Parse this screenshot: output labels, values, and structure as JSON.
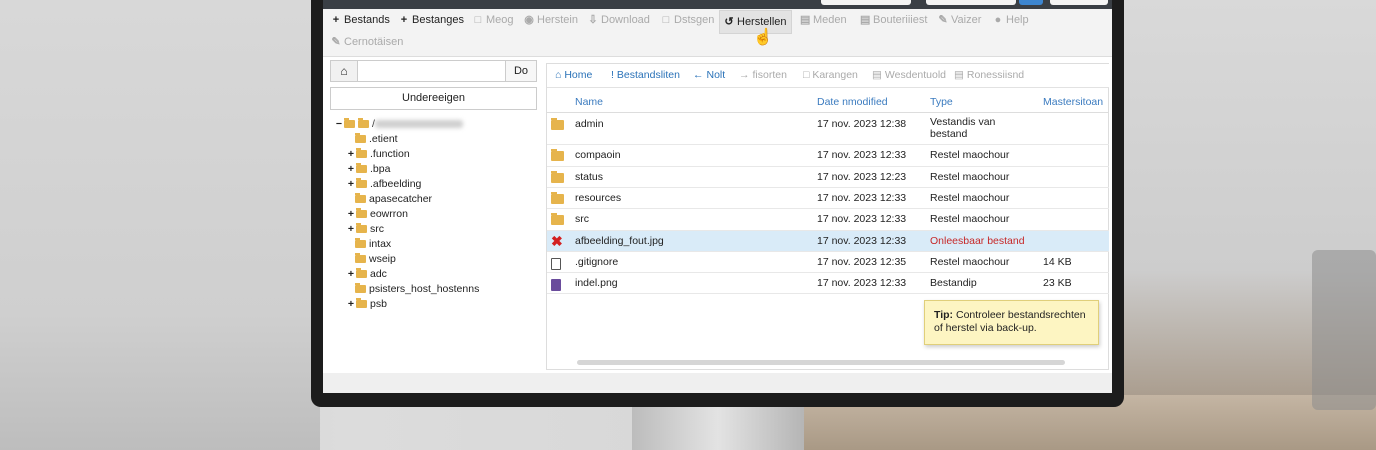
{
  "toolbar": {
    "row1": [
      {
        "icon": "+",
        "label": "Bestands",
        "enabled": true,
        "name": "bestands-button"
      },
      {
        "icon": "+",
        "label": "Bestanges",
        "enabled": true,
        "name": "bestanges-button"
      },
      {
        "icon": "□",
        "label": "Meog",
        "enabled": false,
        "name": "meog-button"
      },
      {
        "icon": "◉",
        "label": "Herstein",
        "enabled": false,
        "name": "herstein-button"
      },
      {
        "icon": "⇩",
        "label": "Download",
        "enabled": false,
        "name": "download-button"
      },
      {
        "icon": "□",
        "label": "Dstsgen",
        "enabled": false,
        "name": "dstsgen-button"
      },
      {
        "icon": "↺",
        "label": "Herstellen",
        "enabled": true,
        "name": "herstellen-button"
      },
      {
        "icon": "▤",
        "label": "Meden",
        "enabled": false,
        "name": "meden-button"
      },
      {
        "icon": "▤",
        "label": "Bouteriiiest",
        "enabled": false,
        "name": "bouteriiiest-button"
      },
      {
        "icon": "✎",
        "label": "Vaizer",
        "enabled": false,
        "name": "vaizer-button"
      },
      {
        "icon": "●",
        "label": "Help",
        "enabled": false,
        "name": "help-button"
      }
    ],
    "row2": [
      {
        "icon": "✎",
        "label": "Cernotäisen",
        "enabled": false,
        "name": "cernotaisen-button"
      }
    ]
  },
  "left": {
    "home_icon": "⌂",
    "path_value": "",
    "go_label": "Do",
    "undereeigen_label": "Undereeigen"
  },
  "tree": [
    {
      "toggle": "−",
      "label": "/",
      "level": 0,
      "root": true
    },
    {
      "toggle": "",
      "label": ".etient",
      "level": 1
    },
    {
      "toggle": "+",
      "label": ".function",
      "level": 1
    },
    {
      "toggle": "+",
      "label": ".bpa",
      "level": 1
    },
    {
      "toggle": "+",
      "label": ".afbeelding",
      "level": 1
    },
    {
      "toggle": "",
      "label": "apasecatcher",
      "level": 1
    },
    {
      "toggle": "+",
      "label": "eowrron",
      "level": 1
    },
    {
      "toggle": "+",
      "label": "src",
      "level": 1
    },
    {
      "toggle": "",
      "label": "intax",
      "level": 1
    },
    {
      "toggle": "",
      "label": "wseip",
      "level": 1
    },
    {
      "toggle": "+",
      "label": "adc",
      "level": 1
    },
    {
      "toggle": "",
      "label": "psisters_host_hostenns",
      "level": 1
    },
    {
      "toggle": "+",
      "label": "psb",
      "level": 1
    }
  ],
  "nav": [
    {
      "icon": "⌂",
      "label": "Home",
      "active": true
    },
    {
      "icon": "!",
      "label": "Bestandsliten",
      "active": true
    },
    {
      "icon": "←",
      "label": "Nolt",
      "active": true
    },
    {
      "icon": "→",
      "label": "fisorten",
      "active": false
    },
    {
      "icon": "□",
      "label": "Karangen",
      "active": false
    },
    {
      "icon": "▤",
      "label": "Wesdentuold",
      "active": false
    },
    {
      "icon": "▤",
      "label": "Ronessiisnd",
      "active": false
    }
  ],
  "columns": {
    "name": "Name",
    "date": "Date nmodified",
    "type": "Type",
    "size": "Mastersitoan"
  },
  "files": [
    {
      "icon": "folder",
      "name": "admin",
      "date": "17 nov. 2023 12:38",
      "type": "Vestandis van bestand",
      "size": "",
      "error": false
    },
    {
      "icon": "folder",
      "name": "compaoin",
      "date": "17 nov. 2023 12:33",
      "type": "Restel maochour",
      "size": "",
      "error": false
    },
    {
      "icon": "folder",
      "name": "status",
      "date": "17 nov. 2023 12:23",
      "type": "Restel maochour",
      "size": "",
      "error": false
    },
    {
      "icon": "folder",
      "name": "resources",
      "date": "17 nov. 2023 12:33",
      "type": "Restel maochour",
      "size": "",
      "error": false
    },
    {
      "icon": "folder",
      "name": "src",
      "date": "17 nov. 2023 12:33",
      "type": "Restel maochour",
      "size": "",
      "error": false
    },
    {
      "icon": "error",
      "name": "afbeelding_fout.jpg",
      "date": "17 nov. 2023 12:33",
      "type": "Onleesbaar bestand",
      "size": "",
      "error": true
    },
    {
      "icon": "file",
      "name": ".gitignore",
      "date": "17 nov. 2023 12:35",
      "type": "Restel maochour",
      "size": "14 KB",
      "error": false
    },
    {
      "icon": "image",
      "name": "indel.png",
      "date": "17 nov. 2023 12:33",
      "type": "Bestandip",
      "size": "23 KB",
      "error": false
    }
  ],
  "tip": {
    "label": "Tip:",
    "text": "Controleer bestandsrechten of herstel via back-up."
  },
  "colors": {
    "accent": "#2a72b8",
    "error": "#c62828",
    "selected_row": "#d9ebf8",
    "folder": "#e6b44c",
    "tip_bg": "#fdf5c2"
  }
}
